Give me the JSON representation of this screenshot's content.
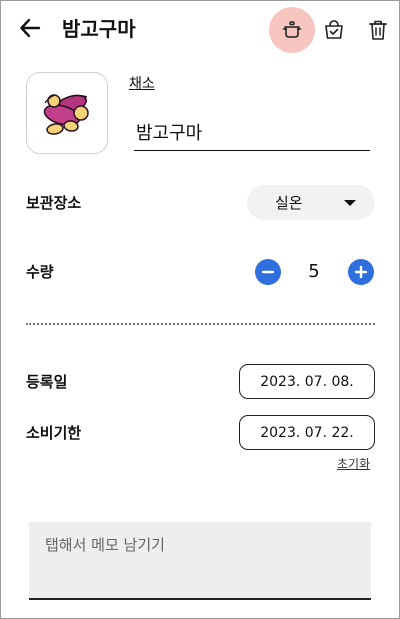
{
  "appbar": {
    "title": "밤고구마",
    "back_icon": "arrow-left-icon",
    "actions": [
      {
        "name": "pot-icon",
        "highlight_color": "#f6c5c0"
      },
      {
        "name": "basket-check-icon"
      },
      {
        "name": "trash-icon"
      }
    ]
  },
  "item": {
    "image_icon": "sweet-potato-icon",
    "category": "채소",
    "name": "밤고구마"
  },
  "storage": {
    "label": "보관장소",
    "selected": "실온"
  },
  "quantity": {
    "label": "수량",
    "value": "5",
    "button_color": "#2f6fdd"
  },
  "dates": {
    "registered_label": "등록일",
    "registered_value": "2023. 07. 08.",
    "expiry_label": "소비기한",
    "expiry_value": "2023. 07. 22.",
    "reset_label": "초기화"
  },
  "memo": {
    "placeholder": "탭해서 메모 남기기",
    "value": ""
  }
}
